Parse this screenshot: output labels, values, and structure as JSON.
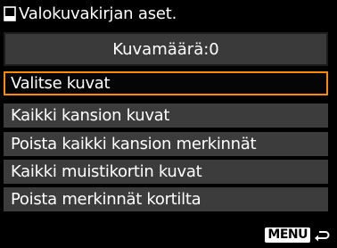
{
  "header": {
    "icon": "photobook-icon",
    "title": "Valokuvakirjan aset."
  },
  "count": {
    "text": "Kuvamäärä:0"
  },
  "menu": {
    "items": [
      {
        "label": "Valitse kuvat",
        "selected": true
      },
      {
        "label": "Kaikki kansion kuvat",
        "selected": false
      },
      {
        "label": "Poista kaikki kansion merkinnät",
        "selected": false
      },
      {
        "label": "Kaikki muistikortin kuvat",
        "selected": false
      },
      {
        "label": "Poista merkinnät kortilta",
        "selected": false
      }
    ]
  },
  "footer": {
    "menu_label": "MENU",
    "return_icon": "return-arrow-icon"
  },
  "colors": {
    "selection_border": "#ff8c00",
    "item_background": "#3c3c3c",
    "screen_background": "#000000"
  }
}
